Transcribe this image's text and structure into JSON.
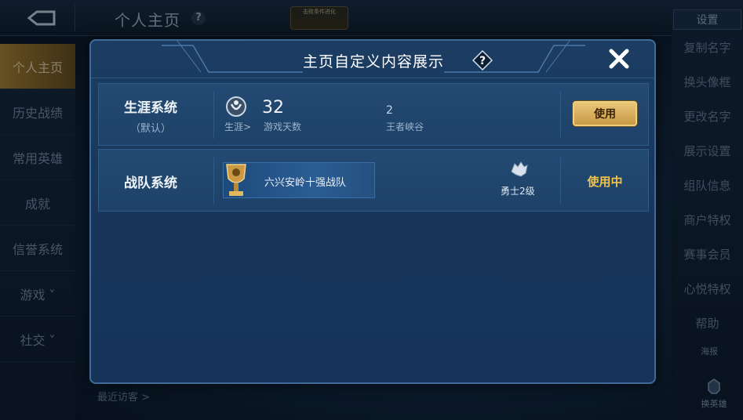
{
  "background": {
    "page_title": "个人主页",
    "help_glyph": "?",
    "event_badge": "击败条件进化",
    "left_nav": [
      {
        "label": "个人主页",
        "active": true
      },
      {
        "label": "历史战绩",
        "active": false
      },
      {
        "label": "常用英雄",
        "active": false
      },
      {
        "label": "成就",
        "active": false
      },
      {
        "label": "信誉系统",
        "active": false
      },
      {
        "label": "游戏 ˅",
        "active": false
      },
      {
        "label": "社交 ˅",
        "active": false
      }
    ],
    "right_menu": {
      "settings_label": "设置",
      "items": [
        "复制名字",
        "换头像框",
        "更改名字",
        "展示设置",
        "组队信息",
        "商户特权",
        "赛事会员",
        "心悦特权",
        "帮助"
      ]
    },
    "report_label": "海报",
    "recent_visitors": "最近访客 >",
    "swap_hero": "换英雄"
  },
  "modal": {
    "title": "主页自定义内容展示",
    "help_glyph": "?",
    "close_glyph": "✕",
    "rows": [
      {
        "system_name": "生涯系统",
        "system_sub": "（默认）",
        "career_link": "生涯>",
        "days_value": "32",
        "days_label": "游戏天数",
        "kings_value": "2",
        "kings_label": "王者峡谷",
        "action_label": "使用",
        "in_use": false
      },
      {
        "system_name": "战队系统",
        "team_name": "六兴安岭十强战队",
        "rank_label": "勇士2级",
        "action_label": "使用中",
        "in_use": true
      }
    ]
  },
  "colors": {
    "accent_gold": "#f2c24a",
    "modal_bg": "#1c3d63",
    "row_bg": "#234a73"
  }
}
